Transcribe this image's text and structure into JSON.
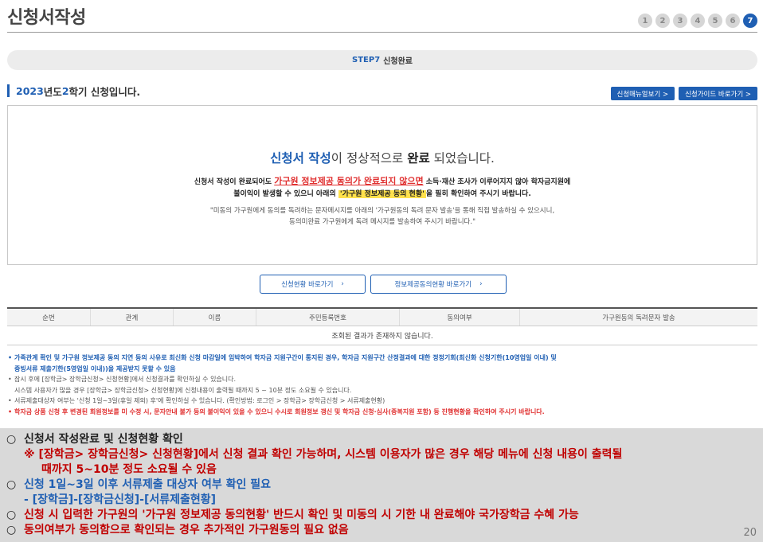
{
  "header": {
    "title": "신청서작성",
    "steps": [
      "1",
      "2",
      "3",
      "4",
      "5",
      "6",
      "7"
    ],
    "active_step": "7"
  },
  "step_bar": {
    "code": "STEP7",
    "label": "신청완료"
  },
  "semester": {
    "year": "2023",
    "text1": "년도 ",
    "term": "2",
    "text2": "학기 신청입니다."
  },
  "top_buttons": [
    "신청매뉴얼보기 >",
    "신청가이드 바로가기 >"
  ],
  "result": {
    "headline_blue": "신청서 작성",
    "headline_mid": "이 정상적으로 ",
    "headline_bold": "완료",
    "headline_end": " 되었습니다.",
    "desc1_pre": "신청서 작성이 완료되어도 ",
    "desc1_red": "가구원 정보제공 동의가 완료되지 않으면",
    "desc1_post": " 소득·재산 조사가 이루어지지 않아 학자금지원에",
    "desc2_pre": "불이익이 발생할 수 있으니 아래의 ",
    "desc2_hl": "'가구원 정보제공 동의 현황'",
    "desc2_post": "을 필히 확인하여 주시기 바랍니다.",
    "note1": "\"미동의 가구원에게 동의를 독려하는 문자메시지를 아래의 '가구원동의 독려 문자 발송'을 통해 직접 발송하실 수 있으시니,",
    "note2": "동의미완료 가구원에게 독려 메시지를 발송하여 주시기 바랍니다.\""
  },
  "mid_buttons": [
    "신청현황 바로가기",
    "정보제공동의현황 바로가기"
  ],
  "table": {
    "headers": [
      "순번",
      "관계",
      "이름",
      "주민등록번호",
      "동의여부",
      "가구원동의 독려문자 발송"
    ],
    "empty_text": "조회된 결과가 존재하지 않습니다."
  },
  "notes": [
    "가족관계 확인 및 가구원 정보제공 동의 지연 등의 사유로 최신화 신청 마감일에 임박하여 학자금 지원구간이 통지된 경우, 학자금 지원구간 산정결과에 대한 정정기회(최신화 신청기한(10영업일 이내) 및",
    "증빙서류 제출기한(5영업일 이내))을 제공받지 못할 수 있음",
    "잠시 후에 [장학금> 장학금신청> 신청현황]에서 신청결과를 확인하실 수 있습니다.",
    "시스템 사용자가 많을 경우 [장학금> 장학금신청> 신청현황]에 신청내용이 출력될 때까지 5 ~ 10분 정도 소요될 수 있습니다.",
    "서류제출대상자 여부는 '신청 1일~3일(휴일 제외) 후'에 확인하실 수 있습니다. (확인방법: 로그인 > 장학금> 장학금신청 > 서류제출현황)",
    "학자금 상품 신청 후 변경된 회원정보를 미 수정 시, 문자안내 불가 등의 불이익이 있을 수 있으니 수시로 회원정보 갱신 및 학자금 신청·심사(중복지원 포함) 등 진행현황을 확인하여 주시기 바랍니다."
  ],
  "overlay": {
    "circle": "○",
    "l1": "신청서 작성완료 및 신청현황 확인",
    "l2": "※ [장학금> 장학금신청> 신청현황]에서 신청 결과 확인 가능하며, 시스템 이용자가 많은 경우 해당 메뉴에 신청 내용이 출력될",
    "l3": "때까지 5~10분 정도 소요될 수 있음",
    "l4": "신청 1일~3일 이후 서류제출 대상자 여부 확인 필요",
    "l5": "- [장학금]-[장학금신청]-[서류제출현황]",
    "l6": "신청 시 입력한 가구원의 '가구원 정보제공 동의현황' 반드시 확인 및 미동의 시 기한 내 완료해야 국가장학금 수혜 가능",
    "l7": "동의여부가 동의함으로 확인되는 경우 추가적인 가구원동의 필요 없음",
    "page_number": "20"
  }
}
